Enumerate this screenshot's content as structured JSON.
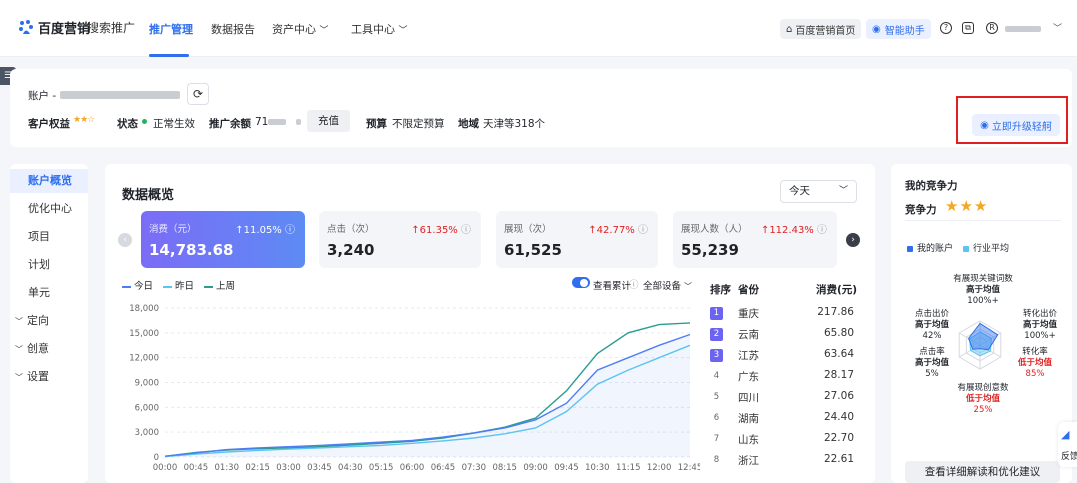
{
  "topbar": {
    "brand": "百度营销",
    "product": "搜索推广",
    "nav": [
      {
        "label": "推广管理",
        "active": true
      },
      {
        "label": "数据报告",
        "active": false
      },
      {
        "label": "资产中心",
        "active": false
      },
      {
        "label": "工具中心",
        "active": false
      }
    ],
    "home_chip": "百度营销首页",
    "assistant_chip": "智能助手"
  },
  "account": {
    "account_label": "账户 -",
    "rights_label": "客户权益",
    "rights_stars": "★★☆",
    "status_label": "状态",
    "status_value": "正常生效",
    "balance_label": "推广余额",
    "balance_value": "71",
    "recharge_button": "充值",
    "budget_label": "预算",
    "budget_value": "不限定预算",
    "region_label": "地域",
    "region_value": "天津等318个",
    "upgrade_button": "立即升级轻舸"
  },
  "left_nav": [
    {
      "label": "账户概览",
      "active": true,
      "expandable": false
    },
    {
      "label": "优化中心",
      "active": false,
      "expandable": false
    },
    {
      "label": "项目",
      "active": false,
      "expandable": false
    },
    {
      "label": "计划",
      "active": false,
      "expandable": false
    },
    {
      "label": "单元",
      "active": false,
      "expandable": false
    },
    {
      "label": "定向",
      "active": false,
      "expandable": true
    },
    {
      "label": "创意",
      "active": false,
      "expandable": true
    },
    {
      "label": "设置",
      "active": false,
      "expandable": true
    }
  ],
  "overview": {
    "title": "数据概览",
    "period": "今天",
    "kpis": [
      {
        "label": "消费（元）",
        "change": "↑11.05%",
        "value": "14,783.68",
        "selected": true
      },
      {
        "label": "点击（次）",
        "change": "↑61.35%",
        "value": "3,240",
        "selected": false
      },
      {
        "label": "展现（次）",
        "change": "↑42.77%",
        "value": "61,525",
        "selected": false
      },
      {
        "label": "展现人数（人）",
        "change": "↑112.43%",
        "value": "55,239",
        "selected": false
      }
    ],
    "cumulative_label": "查看累计",
    "device_label": "全部设备",
    "colors": {
      "today": "#4e7df3",
      "yesterday": "#5cc3f2",
      "lastweek": "#2a9d8f"
    }
  },
  "chart_data": {
    "type": "line",
    "x": [
      "00:00",
      "00:45",
      "01:30",
      "02:15",
      "03:00",
      "03:45",
      "04:30",
      "05:15",
      "06:00",
      "06:45",
      "07:30",
      "08:15",
      "09:00",
      "09:45",
      "10:30",
      "11:15",
      "12:00",
      "12:45"
    ],
    "yticks": [
      "18,000",
      "15,000",
      "12,000",
      "9,000",
      "6,000",
      "3,000",
      "0"
    ],
    "ylim": [
      0,
      18000
    ],
    "series": [
      {
        "name": "今日",
        "values": [
          100,
          500,
          900,
          1100,
          1250,
          1400,
          1600,
          1800,
          2000,
          2400,
          2900,
          3500,
          4500,
          6500,
          10500,
          12000,
          13500,
          14800
        ]
      },
      {
        "name": "昨日",
        "values": [
          50,
          350,
          600,
          800,
          950,
          1100,
          1250,
          1400,
          1650,
          1950,
          2300,
          2800,
          3500,
          5500,
          8800,
          10500,
          12000,
          13500
        ]
      },
      {
        "name": "上周",
        "values": [
          80,
          550,
          850,
          1000,
          1100,
          1250,
          1450,
          1650,
          1900,
          2300,
          2900,
          3600,
          4700,
          8000,
          12500,
          15000,
          16000,
          16200
        ]
      }
    ]
  },
  "ranking": {
    "headers": {
      "rank": "排序",
      "province": "省份",
      "spend": "消费(元)"
    },
    "rows": [
      {
        "rank": "1",
        "province": "重庆",
        "spend": "217.86"
      },
      {
        "rank": "2",
        "province": "云南",
        "spend": "65.80"
      },
      {
        "rank": "3",
        "province": "江苏",
        "spend": "63.64"
      },
      {
        "rank": "4",
        "province": "广东",
        "spend": "28.17"
      },
      {
        "rank": "5",
        "province": "四川",
        "spend": "27.06"
      },
      {
        "rank": "6",
        "province": "湖南",
        "spend": "24.40"
      },
      {
        "rank": "7",
        "province": "山东",
        "spend": "22.70"
      },
      {
        "rank": "8",
        "province": "浙江",
        "spend": "22.61"
      }
    ]
  },
  "competition": {
    "title": "我的竞争力",
    "score_label": "竞争力",
    "stars": "★★★",
    "legend_mine": "我的账户",
    "legend_industry": "行业平均",
    "metrics": {
      "keywords": {
        "name": "有展现关键词数",
        "status": "高于均值",
        "value": "100%+"
      },
      "conv_bid": {
        "name": "转化出价",
        "status": "高于均值",
        "value": "100%+"
      },
      "conv_rate": {
        "name": "转化率",
        "status": "低于均值",
        "value": "85%"
      },
      "creatives": {
        "name": "有展现创意数",
        "status": "低于均值",
        "value": "25%"
      },
      "ctr": {
        "name": "点击率",
        "status": "高于均值",
        "value": "5%"
      },
      "click_bid": {
        "name": "点击出价",
        "status": "高于均值",
        "value": "42%"
      }
    },
    "detail_button": "查看详细解读和优化建议"
  },
  "feedback_label": "反馈"
}
